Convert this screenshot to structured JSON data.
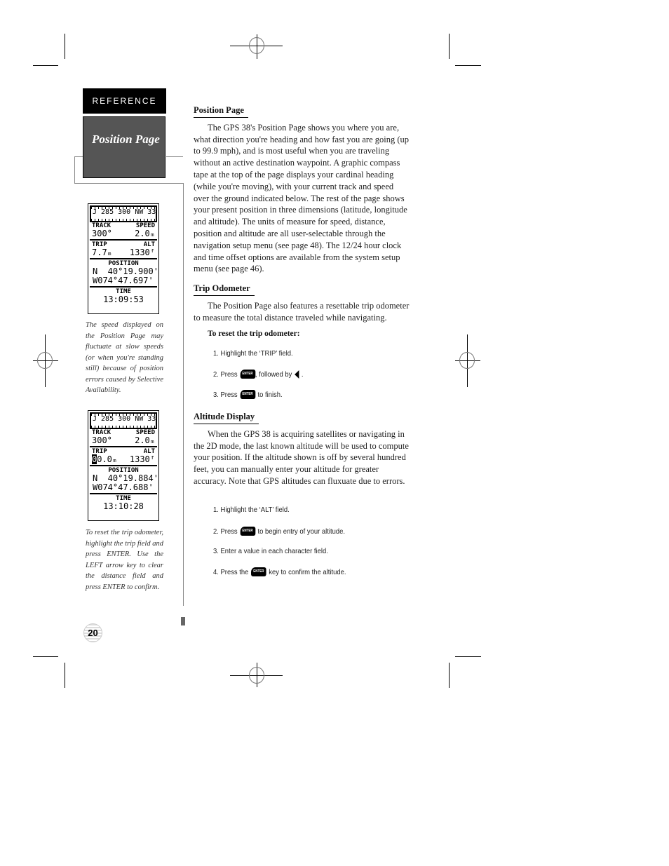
{
  "sidebar": {
    "section_tab": "REFERENCE",
    "section_title": "Position Page",
    "screen1": {
      "tape": "J 285 300 NW 33",
      "track_label": "TRACK",
      "speed_label": "SPEED",
      "track_value": "300°",
      "speed_value": "2.0ₘ",
      "trip_label": "TRIP",
      "alt_label": "ALT",
      "trip_value": "7.7ₘ",
      "alt_value": "1330ᶠ",
      "position_label": "POSITION",
      "lat": "N  40°19.900'",
      "lon": "W074°47.697'",
      "time_label": "TIME",
      "time_value": "13:09:53"
    },
    "caption1": "The speed displayed on the Position Page may fluctuate at slow speeds (or when you're standing still) because of position errors caused by Selective Availability.",
    "screen2": {
      "tape": "J 285 300 NW 33",
      "track_label": "TRACK",
      "speed_label": "SPEED",
      "track_value": "300°",
      "speed_value": "2.0ₘ",
      "trip_label": "TRIP",
      "alt_label": "ALT",
      "trip_cursor": "0",
      "trip_value": "0.0ₘ",
      "alt_value": "1330ᶠ",
      "position_label": "POSITION",
      "lat": "N  40°19.884'",
      "lon": "W074°47.688'",
      "time_label": "TIME",
      "time_value": "13:10:28"
    },
    "caption2": "To reset the trip odometer, highlight the trip field and press ENTER. Use the LEFT arrow key to clear the distance field and press ENTER to confirm."
  },
  "main": {
    "position_page": {
      "heading": "Position Page",
      "body": "The GPS 38's Position Page shows you where you are, what direction you're heading and how fast you are going (up to 99.9 mph), and is most useful when you are traveling without an active destination waypoint. A graphic compass tape at the top of the page displays your cardinal heading (while you're moving), with your current track and speed over the ground indicated below. The rest of the page shows your present position in three dimensions (latitude, longitude and altitude). The units of measure for speed, distance, position and altitude are all user-selectable through the navigation setup menu (see page 48). The 12/24 hour clock and time offset options are available from the system setup menu (see page 46)."
    },
    "trip_odometer": {
      "heading": "Trip Odometer",
      "body": "The Position Page also features a resettable trip odometer to measure the total distance traveled while navigating.",
      "subheading": "To reset the trip odometer:",
      "steps": [
        {
          "pre": "1. Highlight the ‘TRIP’ field.",
          "post": ""
        },
        {
          "pre": "2. Press",
          "post": ", followed by",
          "end": "."
        },
        {
          "pre": "3. Press",
          "post": "to finish."
        }
      ]
    },
    "altitude_display": {
      "heading": "Altitude Display",
      "body": "When the GPS 38 is acquiring satellites or navigating in the 2D mode, the last known altitude will be used to compute your position. If the altitude shown is off by several hundred feet, you can manually enter your altitude for greater accuracy. Note that GPS altitudes can fluxuate due to errors.",
      "steps": [
        {
          "pre": "1. Highlight the ‘ALT’ field.",
          "post": ""
        },
        {
          "pre": "2. Press",
          "post": "to begin entry of your altitude."
        },
        {
          "pre": "3. Enter a value in each character field.",
          "post": ""
        },
        {
          "pre": "4. Press the",
          "post": "key to confirm the altitude."
        }
      ]
    },
    "enter_key_label": "ENTER"
  },
  "footer": {
    "page_number": "20"
  }
}
